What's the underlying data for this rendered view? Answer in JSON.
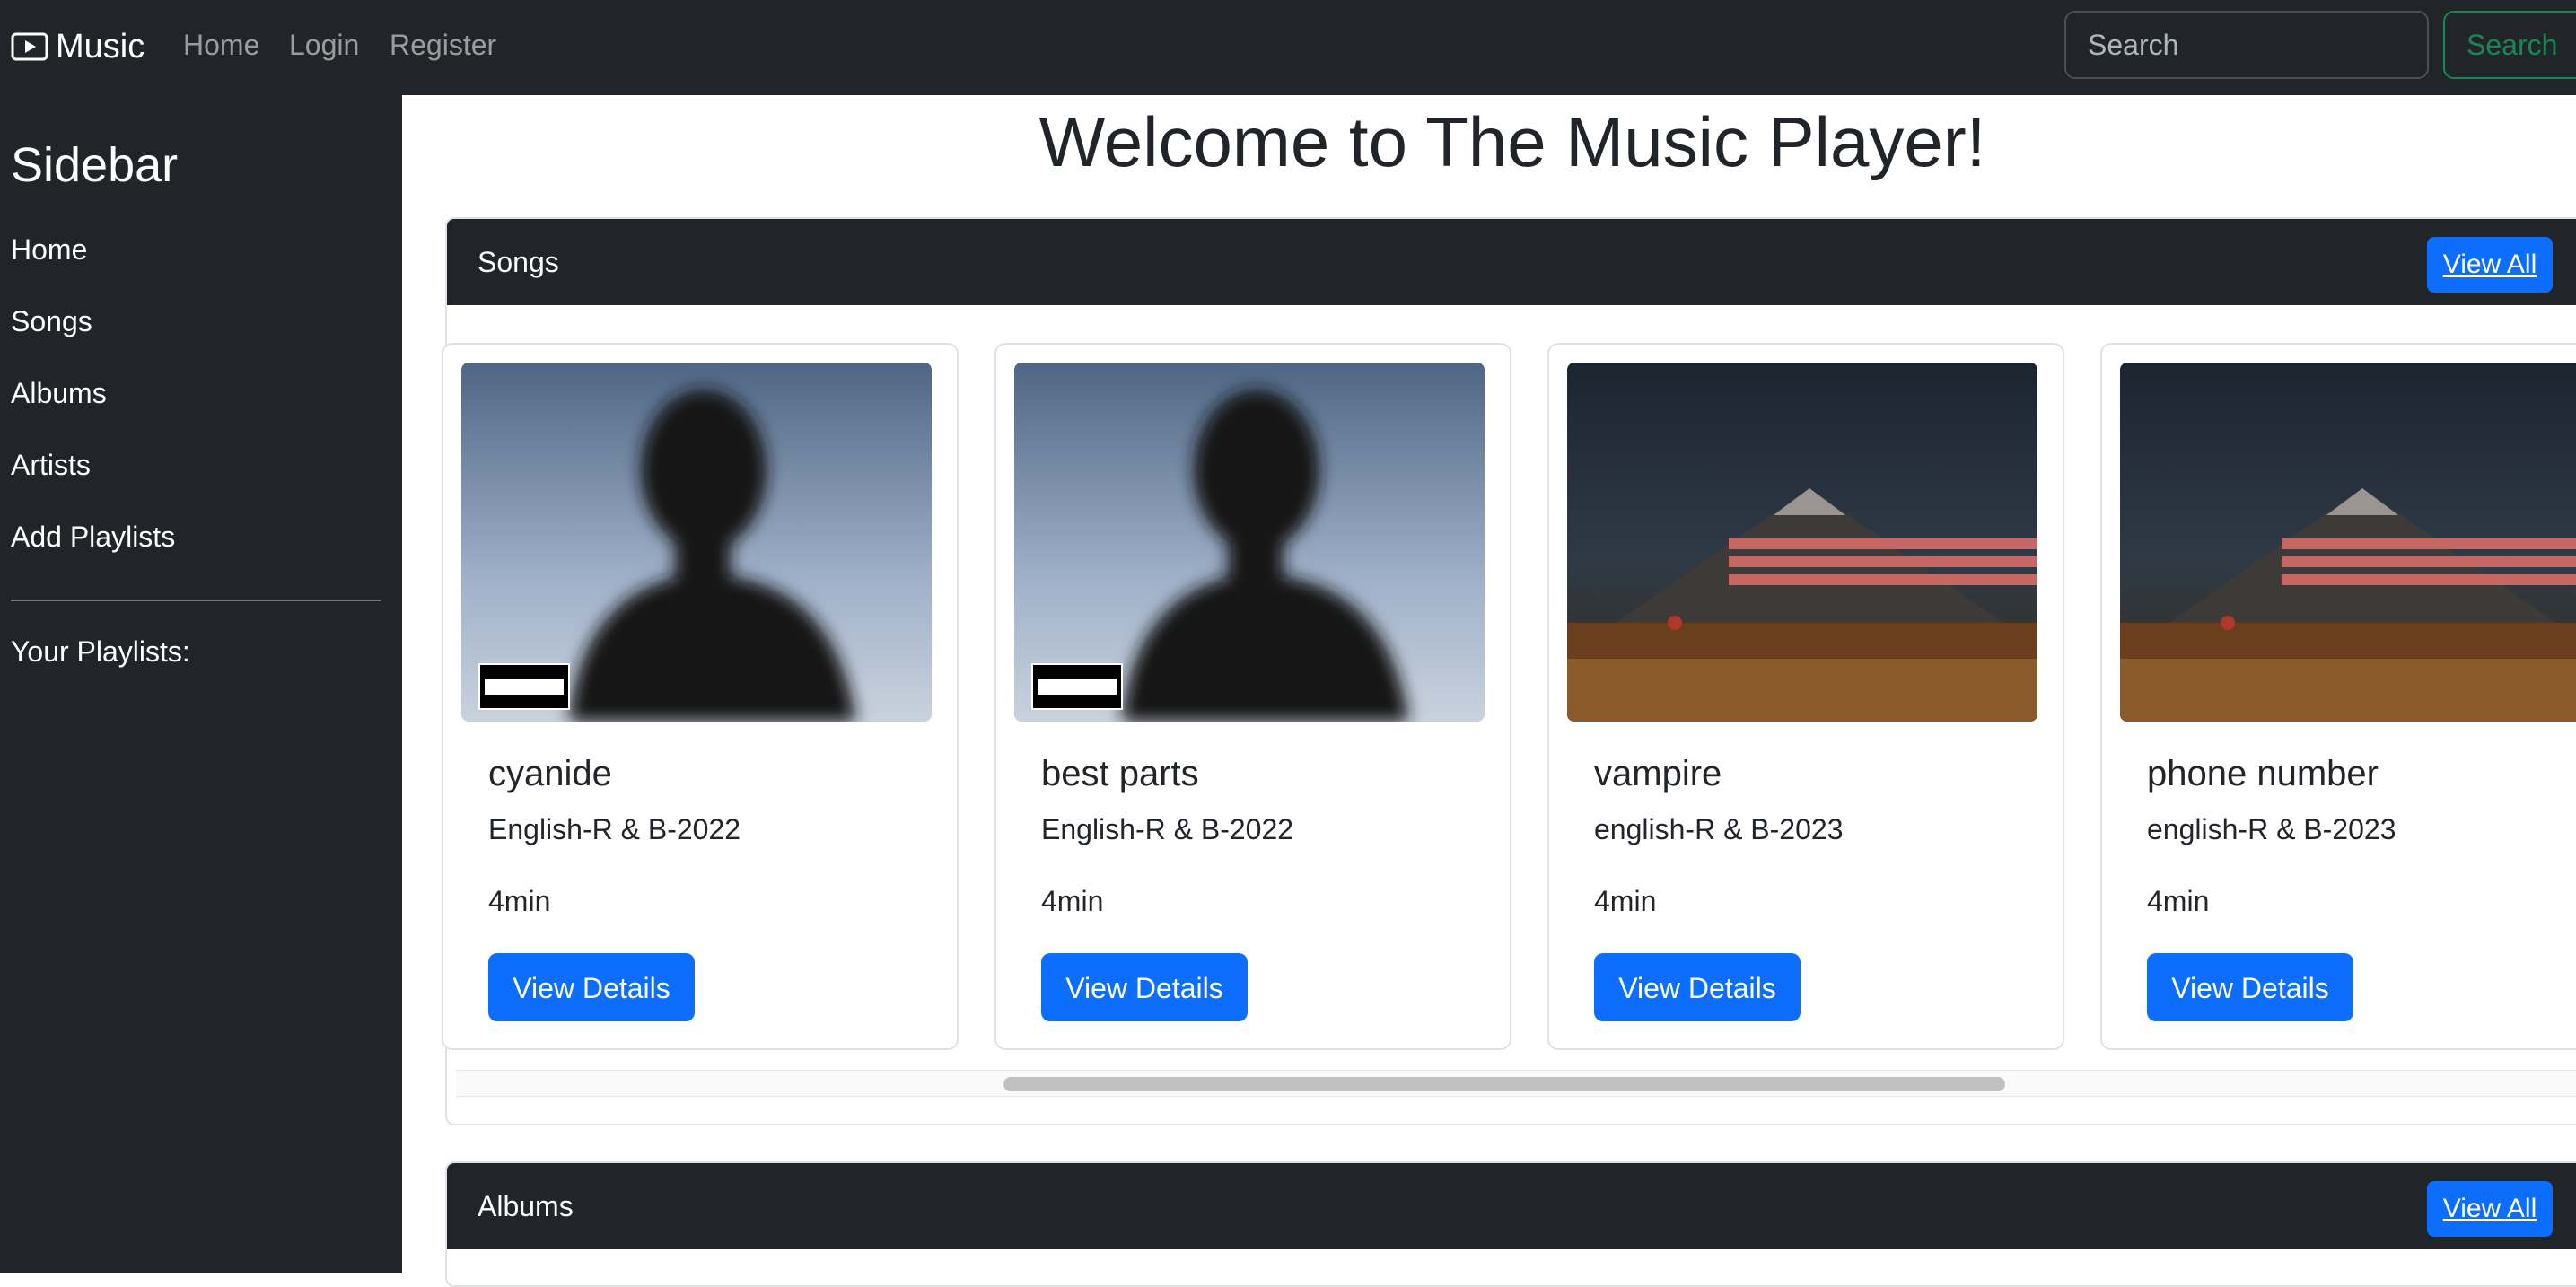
{
  "navbar": {
    "brand": "Music",
    "links": [
      "Home",
      "Login",
      "Register"
    ],
    "search_placeholder": "Search",
    "search_button": "Search"
  },
  "sidebar": {
    "title": "Sidebar",
    "items": [
      "Home",
      "Songs",
      "Albums",
      "Artists",
      "Add Playlists"
    ],
    "playlists_label": "Your Playlists:"
  },
  "main": {
    "title": "Welcome to The Music Player!",
    "songs_panel": {
      "title": "Songs",
      "view_all": "View All",
      "songs": [
        {
          "title": "cyanide",
          "meta": "English-R & B-2022",
          "duration": "4min",
          "button": "View Details",
          "cover": "silhouette-cover",
          "cover_badge": "PARENTAL ADVISORY EXPLICIT CONTENT"
        },
        {
          "title": "best parts",
          "meta": "English-R & B-2022",
          "duration": "4min",
          "button": "View Details",
          "cover": "silhouette-cover",
          "cover_badge": "PARENTAL ADVISORY EXPLICIT CONTENT"
        },
        {
          "title": "vampire",
          "meta": "english-R & B-2023",
          "duration": "4min",
          "button": "View Details",
          "cover": "mountain-cover",
          "cover_text": "WHAT COULD POSSIBLY GO WRONG"
        },
        {
          "title": "phone number",
          "meta": "english-R & B-2023",
          "duration": "4min",
          "button": "View Details",
          "cover": "mountain-cover",
          "cover_text": "WHAT COULD POSSIBLY GO WRONG"
        }
      ]
    },
    "albums_panel": {
      "title": "Albums",
      "view_all": "View All"
    }
  },
  "colors": {
    "dark": "#212529",
    "primary": "#0d6efd",
    "success": "#198754"
  }
}
